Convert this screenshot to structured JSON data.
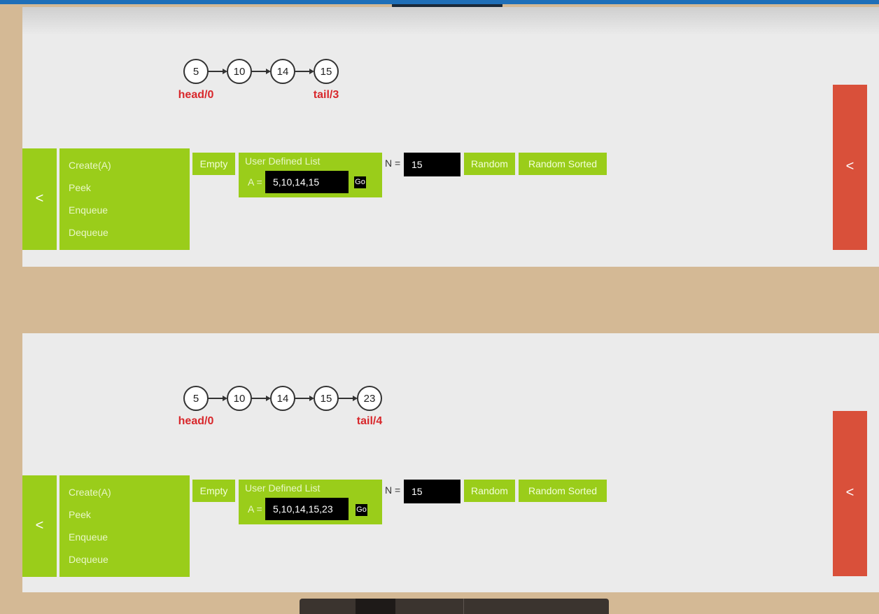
{
  "panels": [
    {
      "nodes": [
        "5",
        "10",
        "14",
        "15"
      ],
      "head_label": "head/0",
      "tail_label": "tail/3",
      "side_tab": "<",
      "menu": [
        "Create(A)",
        "Peek",
        "Enqueue",
        "Dequeue"
      ],
      "empty_label": "Empty",
      "udl_title": "User Defined List",
      "a_label": "A =",
      "a_value": "5,10,14,15",
      "go_label": "Go",
      "n_label": "N =",
      "n_value": "15",
      "random_label": "Random",
      "random_sorted_label": "Random Sorted",
      "collapse_tab": "<"
    },
    {
      "nodes": [
        "5",
        "10",
        "14",
        "15",
        "23"
      ],
      "head_label": "head/0",
      "tail_label": "tail/4",
      "side_tab": "<",
      "menu": [
        "Create(A)",
        "Peek",
        "Enqueue",
        "Dequeue"
      ],
      "empty_label": "Empty",
      "udl_title": "User Defined List",
      "a_label": "A =",
      "a_value": "5,10,14,15,23",
      "go_label": "Go",
      "n_label": "N =",
      "n_value": "15",
      "random_label": "Random",
      "random_sorted_label": "Random Sorted",
      "collapse_tab": "<"
    }
  ],
  "colors": {
    "background": "#d4b995",
    "panel": "#ebebeb",
    "action_green": "#9acd1a",
    "collapse_red": "#d9503a",
    "pointer_label_red": "#d8272b",
    "top_bar_blue": "#1f6fb8"
  }
}
